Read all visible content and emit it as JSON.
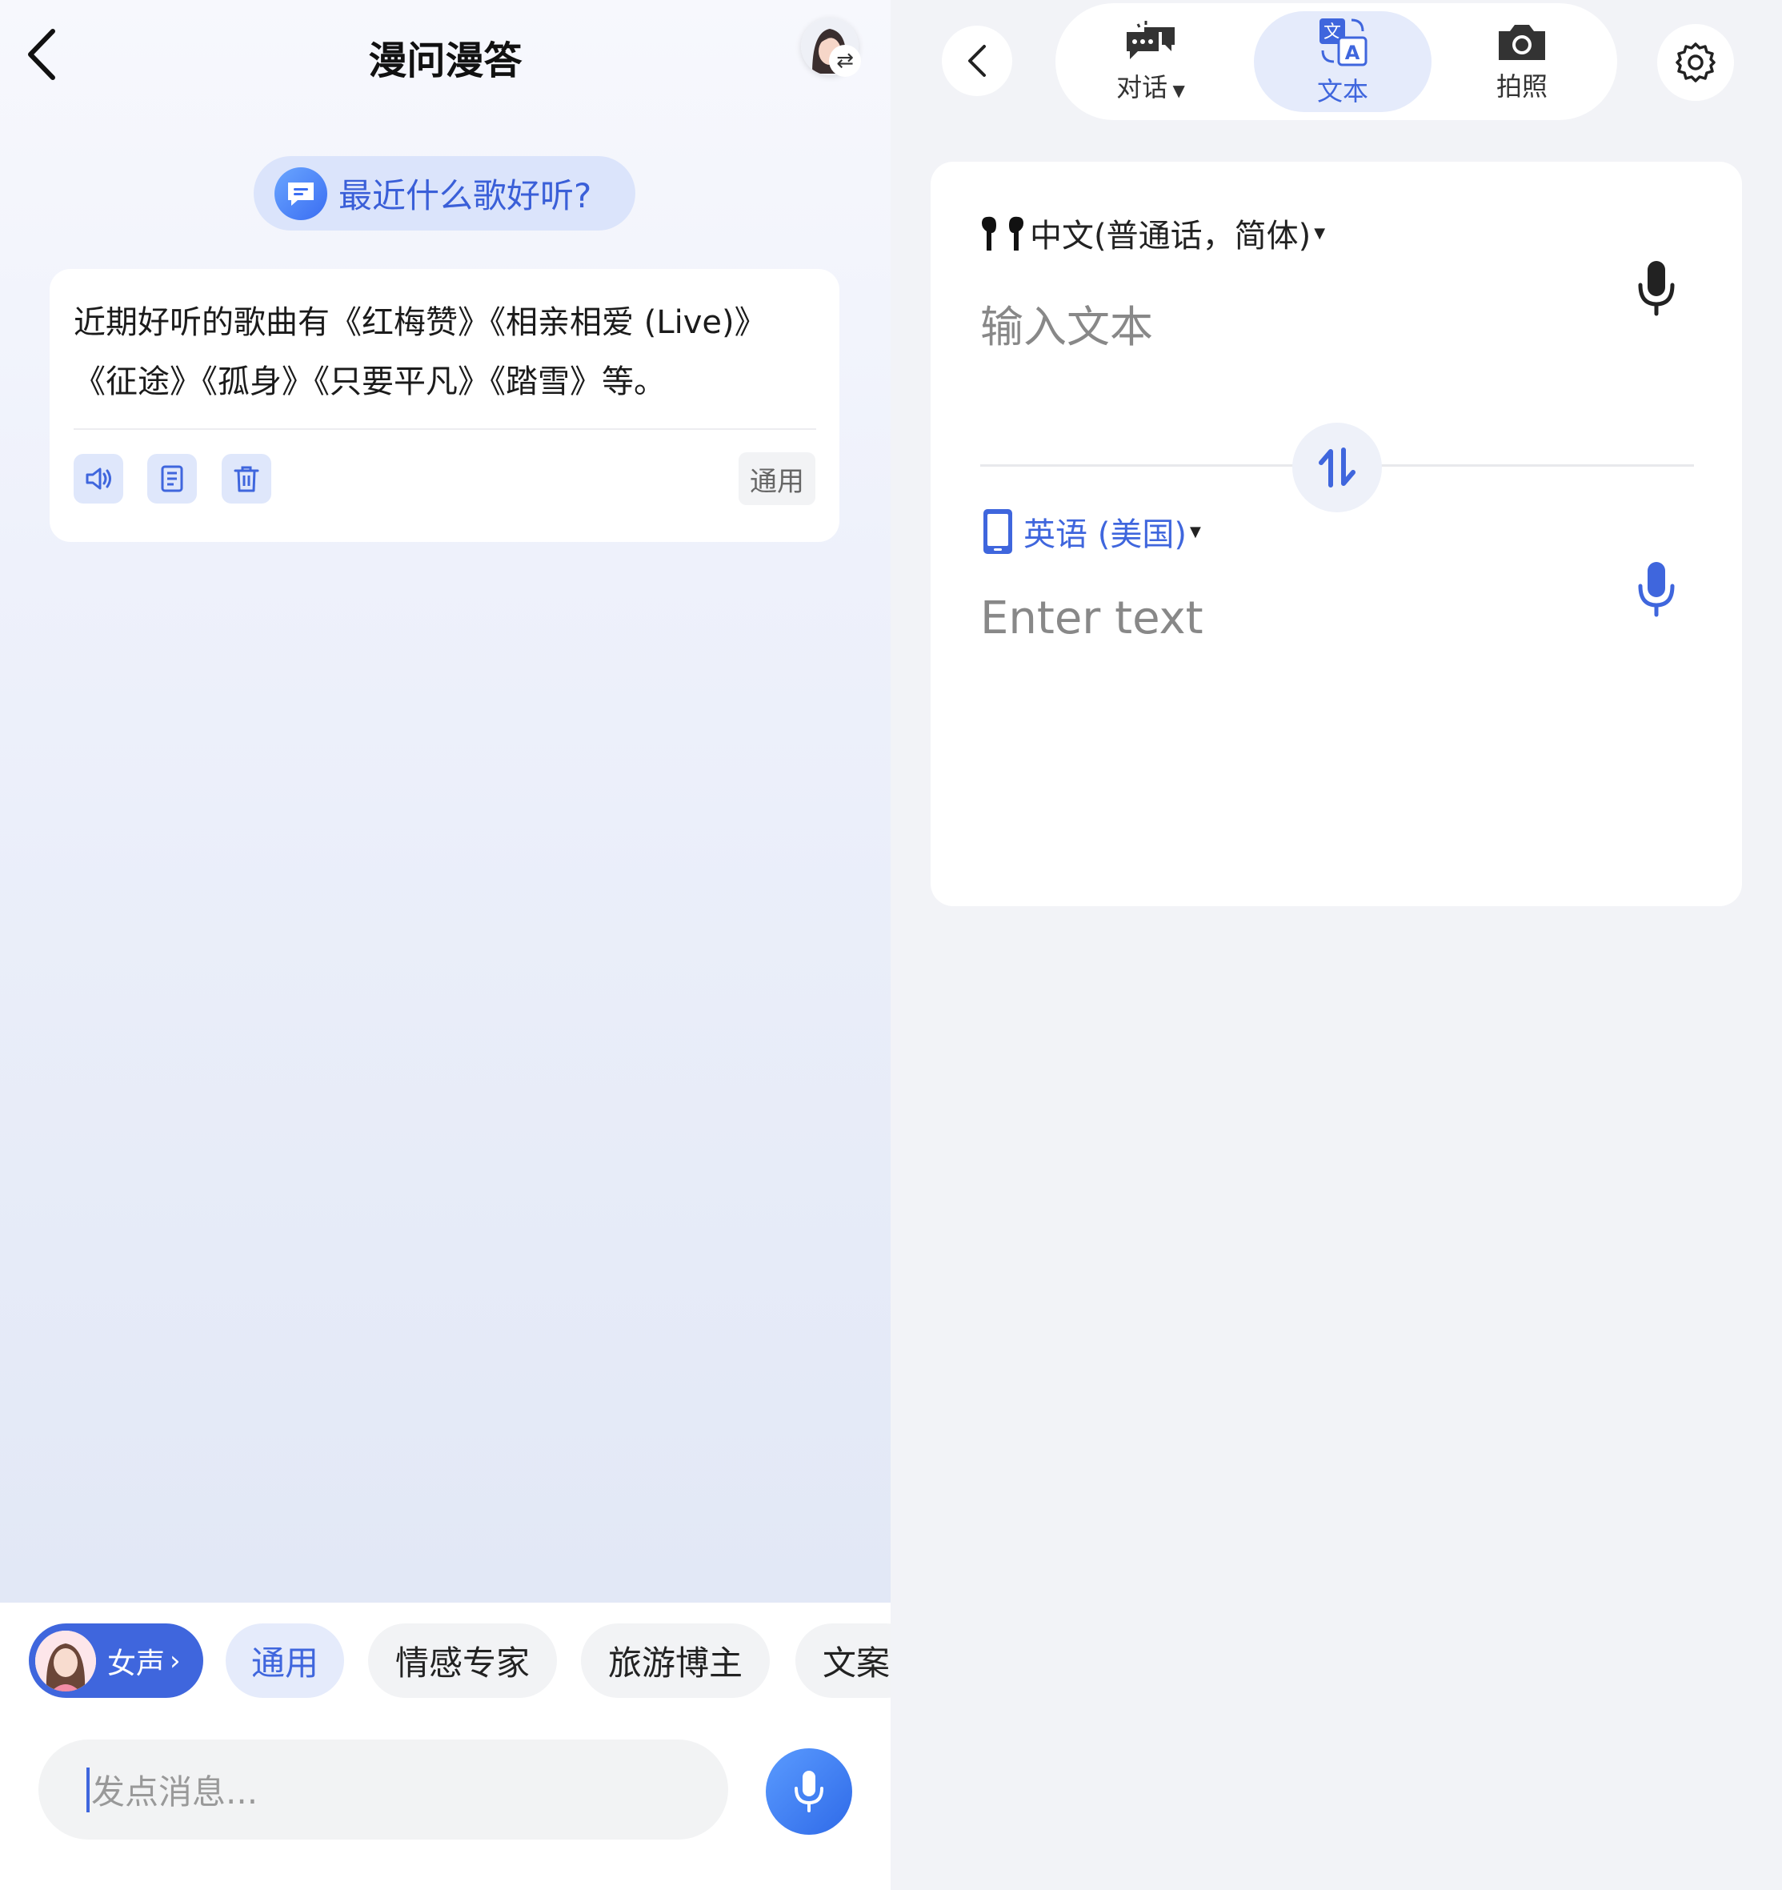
{
  "left": {
    "title": "漫问漫答",
    "icons": {
      "back": "chevron-left-icon",
      "avatar": "avatar-swap-icon"
    },
    "question": "最近什么歌好听?",
    "answer": {
      "text_line1": "近期好听的歌曲有《红梅赞》《相亲相爱 (Live)》",
      "text_line2": "《征途》《孤身》《只要平凡》《踏雪》等。",
      "tag": "通用",
      "actions": [
        "speaker-icon",
        "copy-icon",
        "trash-icon"
      ]
    },
    "voice_chip": {
      "label": "女声",
      "arrow": "›"
    },
    "chips": [
      "通用",
      "情感专家",
      "旅游博主",
      "文案"
    ],
    "active_chip": "通用",
    "input": {
      "placeholder": "发点消息..."
    },
    "colors": {
      "accent": "#3f66dd",
      "question_bg": "#dbe4fb"
    }
  },
  "right": {
    "modes": [
      {
        "label": "对话",
        "icon": "conversation-icon",
        "has_dropdown": true
      },
      {
        "label": "文本",
        "icon": "translate-text-icon",
        "active": true
      },
      {
        "label": "拍照",
        "icon": "camera-icon"
      }
    ],
    "source": {
      "language": "中文(普通话，简体)",
      "device_icon": "earbuds-icon",
      "placeholder": "输入文本"
    },
    "target": {
      "language": "英语 (美国)",
      "device_icon": "phone-icon",
      "placeholder": "Enter text"
    },
    "icons": {
      "back": "chevron-left-icon",
      "settings": "gear-icon",
      "swap": "swap-vertical-icon",
      "mic": "microphone-icon"
    }
  }
}
